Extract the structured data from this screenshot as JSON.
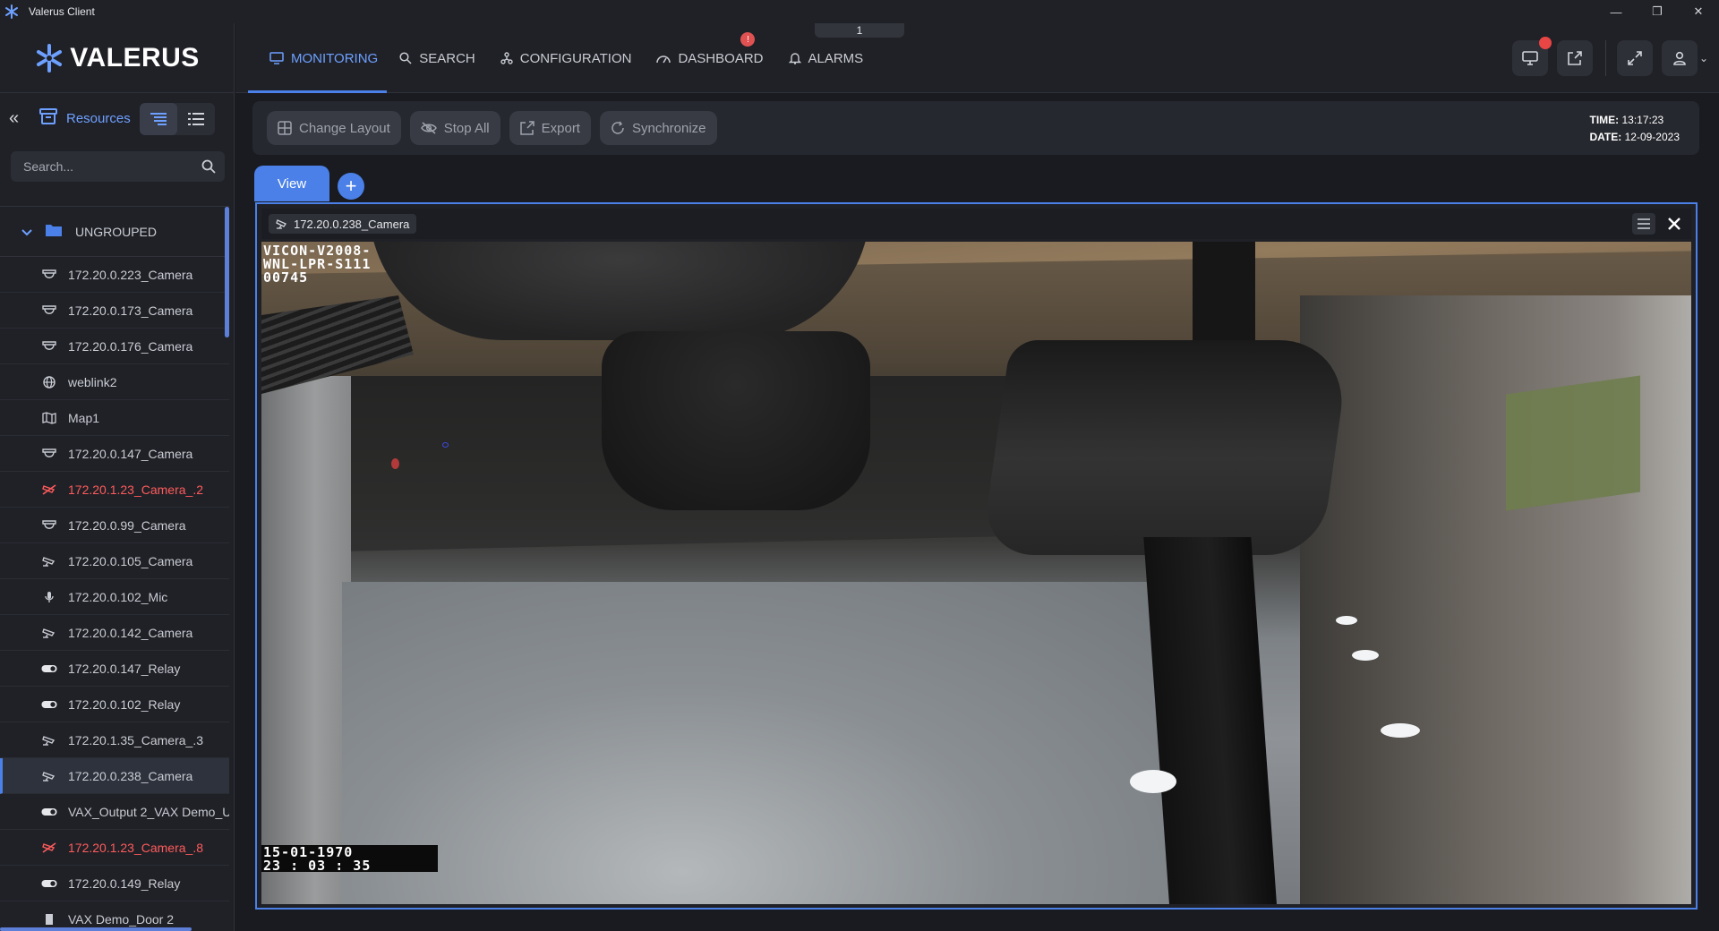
{
  "window": {
    "title": "Valerus Client"
  },
  "brand": {
    "logo_text": "VALERUS"
  },
  "nav": {
    "tabs": [
      {
        "label": "MONITORING",
        "icon": "monitor-icon"
      },
      {
        "label": "SEARCH",
        "icon": "search-icon"
      },
      {
        "label": "CONFIGURATION",
        "icon": "configuration-icon"
      },
      {
        "label": "DASHBOARD",
        "icon": "dashboard-icon"
      },
      {
        "label": "ALARMS",
        "icon": "alarm-bell-icon"
      }
    ],
    "active_tab": "MONITORING",
    "dashboard_badge": "!",
    "page_indicator": "1"
  },
  "sidebar": {
    "resources_label": "Resources",
    "search_placeholder": "Search...",
    "group_label": "UNGROUPED",
    "items": [
      {
        "label": "172.20.0.223_Camera",
        "icon": "dome-camera-icon",
        "status": "normal"
      },
      {
        "label": "172.20.0.173_Camera",
        "icon": "dome-camera-icon",
        "status": "normal"
      },
      {
        "label": "172.20.0.176_Camera",
        "icon": "dome-camera-icon",
        "status": "normal"
      },
      {
        "label": "weblink2",
        "icon": "weblink-icon",
        "status": "normal"
      },
      {
        "label": "Map1",
        "icon": "map-icon",
        "status": "normal"
      },
      {
        "label": "172.20.0.147_Camera",
        "icon": "dome-camera-icon",
        "status": "normal"
      },
      {
        "label": "172.20.1.23_Camera_.2",
        "icon": "camera-offline-icon",
        "status": "error"
      },
      {
        "label": "172.20.0.99_Camera",
        "icon": "dome-camera-icon",
        "status": "normal"
      },
      {
        "label": "172.20.0.105_Camera",
        "icon": "camera-icon",
        "status": "normal"
      },
      {
        "label": "172.20.0.102_Mic",
        "icon": "microphone-icon",
        "status": "normal"
      },
      {
        "label": "172.20.0.142_Camera",
        "icon": "camera-icon",
        "status": "normal"
      },
      {
        "label": "172.20.0.147_Relay",
        "icon": "relay-toggle-icon",
        "status": "normal"
      },
      {
        "label": "172.20.0.102_Relay",
        "icon": "relay-toggle-icon",
        "status": "normal"
      },
      {
        "label": "172.20.1.35_Camera_.3",
        "icon": "camera-icon",
        "status": "normal"
      },
      {
        "label": "172.20.0.238_Camera",
        "icon": "camera-icon",
        "status": "selected"
      },
      {
        "label": "VAX_Output 2_VAX Demo_U",
        "icon": "relay-toggle-icon",
        "status": "normal"
      },
      {
        "label": "172.20.1.23_Camera_.8",
        "icon": "camera-offline-icon",
        "status": "error"
      },
      {
        "label": "172.20.0.149_Relay",
        "icon": "relay-toggle-icon",
        "status": "normal"
      },
      {
        "label": "VAX Demo_Door 2",
        "icon": "door-icon",
        "status": "normal"
      }
    ]
  },
  "toolbar": {
    "change_layout": "Change Layout",
    "stop_all": "Stop All",
    "export": "Export",
    "synchronize": "Synchronize",
    "time_label": "TIME:",
    "time_value": "13:17:23",
    "date_label": "DATE:",
    "date_value": "12-09-2023"
  },
  "views": {
    "tabs": [
      {
        "label": "View"
      }
    ],
    "add_label": "+"
  },
  "video": {
    "camera_name": "172.20.0.238_Camera",
    "osd_line1": "VICON-V2008-",
    "osd_line2": "WNL-LPR-S111",
    "osd_line3": "00745",
    "osd_date": "15-01-1970",
    "osd_time": "23 : 03 : 35"
  },
  "colors": {
    "accent": "#4a80e8",
    "accent_text": "#6da0ff",
    "error": "#ff5b5b",
    "badge": "#e84545",
    "background": "#1a1b21",
    "panel": "#202127"
  }
}
